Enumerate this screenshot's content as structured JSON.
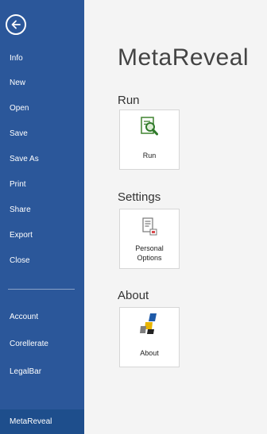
{
  "app": {
    "title": "MetaReveal",
    "accent": "#2b579a",
    "selected_bg": "#1e4e8c"
  },
  "sidebar": {
    "back_icon": "back-arrow-circle-icon",
    "items": [
      {
        "label": "Info"
      },
      {
        "label": "New"
      },
      {
        "label": "Open"
      },
      {
        "label": "Save"
      },
      {
        "label": "Save As"
      },
      {
        "label": "Print"
      },
      {
        "label": "Share"
      },
      {
        "label": "Export"
      },
      {
        "label": "Close"
      },
      {
        "label": "Account"
      },
      {
        "label": "Corellerate"
      },
      {
        "label": "LegalBar"
      },
      {
        "label": "MetaReveal",
        "selected": true
      }
    ]
  },
  "sections": {
    "run": {
      "heading": "Run",
      "tile_label": "Run",
      "icon": "document-magnifier-icon"
    },
    "settings": {
      "heading": "Settings",
      "tile_label_line1": "Personal",
      "tile_label_line2": "Options",
      "icon": "options-document-icon"
    },
    "about": {
      "heading": "About",
      "tile_label": "About",
      "icon": "metareveal-logo-icon"
    }
  }
}
